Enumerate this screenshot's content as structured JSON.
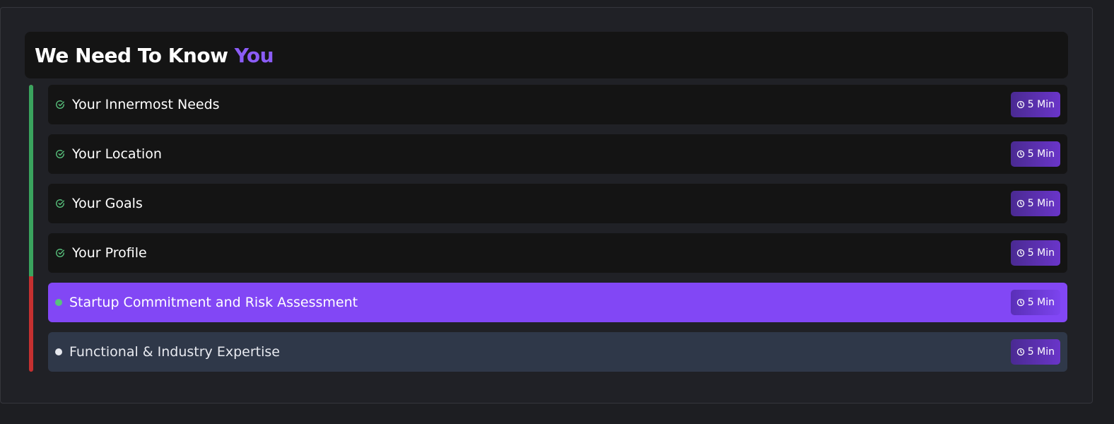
{
  "header": {
    "title_prefix": "We Need To Know",
    "title_accent": "You"
  },
  "colors": {
    "accent": "#8b5cf6",
    "active_step": "#8247f5",
    "pending_step": "#2f3849",
    "complete_check": "#58c27d",
    "progress_done": "#3aa35e",
    "progress_remaining": "#c53030"
  },
  "progress": {
    "completed_steps": 4,
    "total_steps": 6
  },
  "steps": [
    {
      "label": "Your Innermost Needs",
      "duration": "5 Min",
      "status": "complete",
      "icon": "check-circle-icon"
    },
    {
      "label": "Your Location",
      "duration": "5 Min",
      "status": "complete",
      "icon": "check-circle-icon"
    },
    {
      "label": "Your Goals",
      "duration": "5 Min",
      "status": "complete",
      "icon": "check-circle-icon"
    },
    {
      "label": "Your Profile",
      "duration": "5 Min",
      "status": "complete",
      "icon": "check-circle-icon"
    },
    {
      "label": "Startup Commitment and Risk Assessment",
      "duration": "5 Min",
      "status": "active",
      "icon": "status-dot-icon"
    },
    {
      "label": "Functional & Industry Expertise",
      "duration": "5 Min",
      "status": "pending",
      "icon": "status-dot-icon"
    }
  ],
  "badge_icon": "clock-icon"
}
